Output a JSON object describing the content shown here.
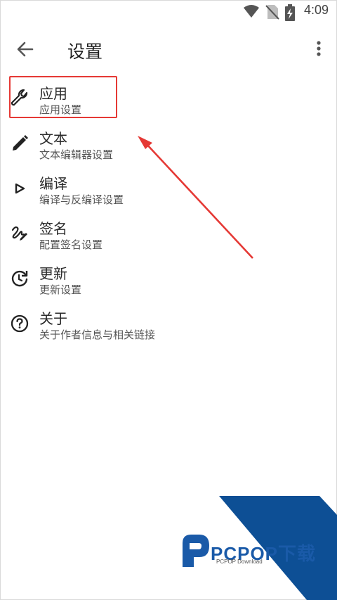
{
  "status_bar": {
    "time": "4:09",
    "icons": [
      "wifi-icon",
      "no-sim-icon",
      "battery-charging-icon"
    ]
  },
  "toolbar": {
    "title": "设置",
    "back_icon": "arrow-back-icon",
    "more_icon": "more-vertical-icon"
  },
  "settings": {
    "items": [
      {
        "title": "应用",
        "subtitle": "应用设置",
        "icon": "wrench-icon"
      },
      {
        "title": "文本",
        "subtitle": "文本编辑器设置",
        "icon": "pencil-icon"
      },
      {
        "title": "编译",
        "subtitle": "编译与反编译设置",
        "icon": "play-icon"
      },
      {
        "title": "签名",
        "subtitle": "配置签名设置",
        "icon": "signature-icon"
      },
      {
        "title": "更新",
        "subtitle": "更新设置",
        "icon": "update-icon"
      },
      {
        "title": "关于",
        "subtitle": "关于作者信息与相关链接",
        "icon": "help-icon"
      }
    ]
  },
  "watermark": {
    "brand": "PCPOP下载",
    "sub": "PCPOP Download",
    "colors": {
      "blue": "#1a5aa8",
      "dark_blue": "#0d4f95"
    }
  },
  "colors": {
    "annotation_red": "#e53935",
    "text_primary": "#2a2a2a",
    "text_secondary": "#555555"
  }
}
